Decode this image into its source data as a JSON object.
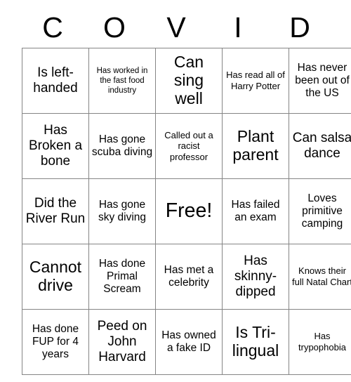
{
  "card": {
    "title_letters": [
      "C",
      "O",
      "V",
      "I",
      "D"
    ],
    "rows": [
      [
        {
          "text": "Is left-handed",
          "size": "fs-l"
        },
        {
          "text": "Has worked in the fast food industry",
          "size": "fs-xs"
        },
        {
          "text": "Can sing well",
          "size": "fs-xl"
        },
        {
          "text": "Has read all of Harry Potter",
          "size": "fs-s"
        },
        {
          "text": "Has never been out of the US",
          "size": "fs-m"
        }
      ],
      [
        {
          "text": "Has Broken a bone",
          "size": "fs-l"
        },
        {
          "text": "Has gone scuba diving",
          "size": "fs-m"
        },
        {
          "text": "Called out a racist professor",
          "size": "fs-s"
        },
        {
          "text": "Plant parent",
          "size": "fs-xl"
        },
        {
          "text": "Can salsa dance",
          "size": "fs-l"
        }
      ],
      [
        {
          "text": "Did the River Run",
          "size": "fs-l"
        },
        {
          "text": "Has gone sky diving",
          "size": "fs-m"
        },
        {
          "text": "Free!",
          "size": "fs-xxl"
        },
        {
          "text": "Has failed an exam",
          "size": "fs-m"
        },
        {
          "text": "Loves primitive camping",
          "size": "fs-m"
        }
      ],
      [
        {
          "text": "Cannot drive",
          "size": "fs-xl"
        },
        {
          "text": "Has done Primal Scream",
          "size": "fs-m"
        },
        {
          "text": "Has met a celebrity",
          "size": "fs-m"
        },
        {
          "text": "Has skinny-dipped",
          "size": "fs-l"
        },
        {
          "text": "Knows their full Natal Chart",
          "size": "fs-s"
        }
      ],
      [
        {
          "text": "Has done FUP for 4 years",
          "size": "fs-m"
        },
        {
          "text": "Peed on John Harvard",
          "size": "fs-l"
        },
        {
          "text": "Has owned a fake ID",
          "size": "fs-m"
        },
        {
          "text": "Is Tri-lingual",
          "size": "fs-xl"
        },
        {
          "text": "Has trypophobia",
          "size": "fs-s"
        }
      ]
    ],
    "colors": {
      "border": "#858585",
      "text": "#000000",
      "background": "#ffffff"
    }
  }
}
